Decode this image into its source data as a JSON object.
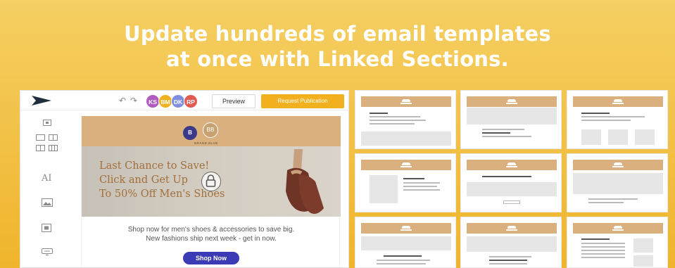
{
  "headline": {
    "line1": "Update hundreds of email templates",
    "line2": "at once with Linked Sections."
  },
  "toolbar": {
    "undo_icon": "undo-icon",
    "redo_icon": "redo-icon",
    "avatars": [
      {
        "initials": "KS",
        "color": "#b05bc2"
      },
      {
        "initials": "BM",
        "color": "#f2b01e"
      },
      {
        "initials": "DK",
        "color": "#7f8fe0"
      },
      {
        "initials": "RP",
        "color": "#e35a52"
      }
    ],
    "preview_label": "Preview",
    "request_label": "Request Publication"
  },
  "sidebar": {
    "icons": [
      "image-block-icon",
      "two-column-icon",
      "three-column-icon",
      "text-block-icon",
      "image-icon",
      "video-icon",
      "button-icon"
    ],
    "text_tool": "AI"
  },
  "email": {
    "brand_mark": "B",
    "brand_mark2": "BB",
    "brand_name": "BRAND BLUE",
    "hero_lines": [
      "Last Chance to Save!",
      "Click and Get Up",
      "To 50% Off Men's Shoes"
    ],
    "body_line1": "Shop now for men's shoes & accessories to save big.",
    "body_line2": "New fashions ship next week - get in now.",
    "cta": "Shop Now"
  },
  "colors": {
    "accent": "#f2b01e",
    "header_band": "#d9b07e",
    "cta": "#3b3bb5",
    "hero_text": "#a26f3b"
  },
  "templates_count": 9
}
